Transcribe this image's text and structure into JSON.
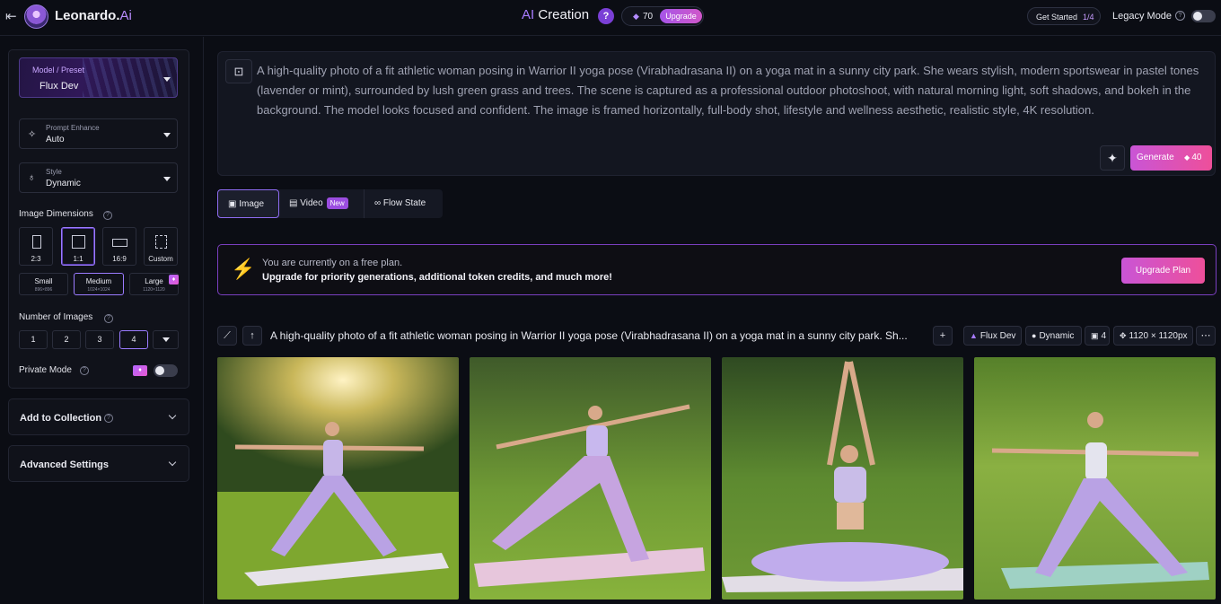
{
  "header": {
    "brand_name": "Leonardo.",
    "brand_suffix": "Ai",
    "title_prefix": "AI",
    "title_main": " Creation",
    "help_glyph": "?",
    "token_count": "70",
    "upgrade_label": "Upgrade",
    "get_started_label": "Get Started",
    "get_started_progress": "1/4",
    "legacy_mode_label": "Legacy Mode",
    "legacy_mode_enabled": false
  },
  "sidebar": {
    "model_label": "Model / Preset",
    "model_value": "Flux Dev",
    "prompt_enhance_label": "Prompt Enhance",
    "prompt_enhance_value": "Auto",
    "style_label": "Style",
    "style_value": "Dynamic",
    "image_dimensions_label": "Image Dimensions",
    "dimensions": [
      {
        "label": "2:3",
        "active": false
      },
      {
        "label": "1:1",
        "active": true
      },
      {
        "label": "16:9",
        "active": false
      },
      {
        "label": "Custom",
        "active": false
      }
    ],
    "sizes": [
      {
        "label": "Small",
        "sub": "896×896",
        "active": false
      },
      {
        "label": "Medium",
        "sub": "1024×1024",
        "active": true
      },
      {
        "label": "Large",
        "sub": "1120×1120",
        "active": false
      }
    ],
    "number_of_images_label": "Number of Images",
    "number_options": [
      "1",
      "2",
      "3",
      "4"
    ],
    "number_selected": "4",
    "private_mode_label": "Private Mode",
    "private_mode_enabled": false,
    "add_to_collection_label": "Add to Collection",
    "advanced_settings_label": "Advanced Settings"
  },
  "prompt": {
    "text": "A high-quality photo of a fit athletic woman posing in Warrior II yoga pose (Virabhadrasana II) on a yoga mat in a sunny city park. She wears stylish, modern sportswear in pastel tones (lavender or mint), surrounded by lush green grass and trees. The scene is captured as a professional outdoor photoshoot, with natural morning light, soft shadows, and bokeh in the background. The model looks focused and confident. The image is framed horizontally, full-body shot, lifestyle and wellness aesthetic, realistic style, 4K resolution.",
    "generate_label": "Generate",
    "generate_cost": "40"
  },
  "mode_tabs": [
    {
      "label": "Image",
      "active": true
    },
    {
      "label": "Video",
      "badge": "New",
      "active": false
    },
    {
      "label": "Flow State",
      "active": false
    }
  ],
  "promo": {
    "line1": "You are currently on a free plan.",
    "line2": "Upgrade for priority generations, additional token credits, and much more!",
    "button_label": "Upgrade Plan"
  },
  "generation": {
    "prompt_preview": "A high-quality photo of a fit athletic woman posing in Warrior II yoga pose (Virabhadrasana II) on a yoga mat in a sunny city park. Sh...",
    "model_chip": "Flux Dev",
    "style_chip": "Dynamic",
    "count_chip": "4",
    "size_chip": "1120 × 1120px"
  },
  "colors": {
    "accent": "#9b7bff",
    "cta_start": "#c955d6",
    "cta_end": "#ee4f9a"
  }
}
